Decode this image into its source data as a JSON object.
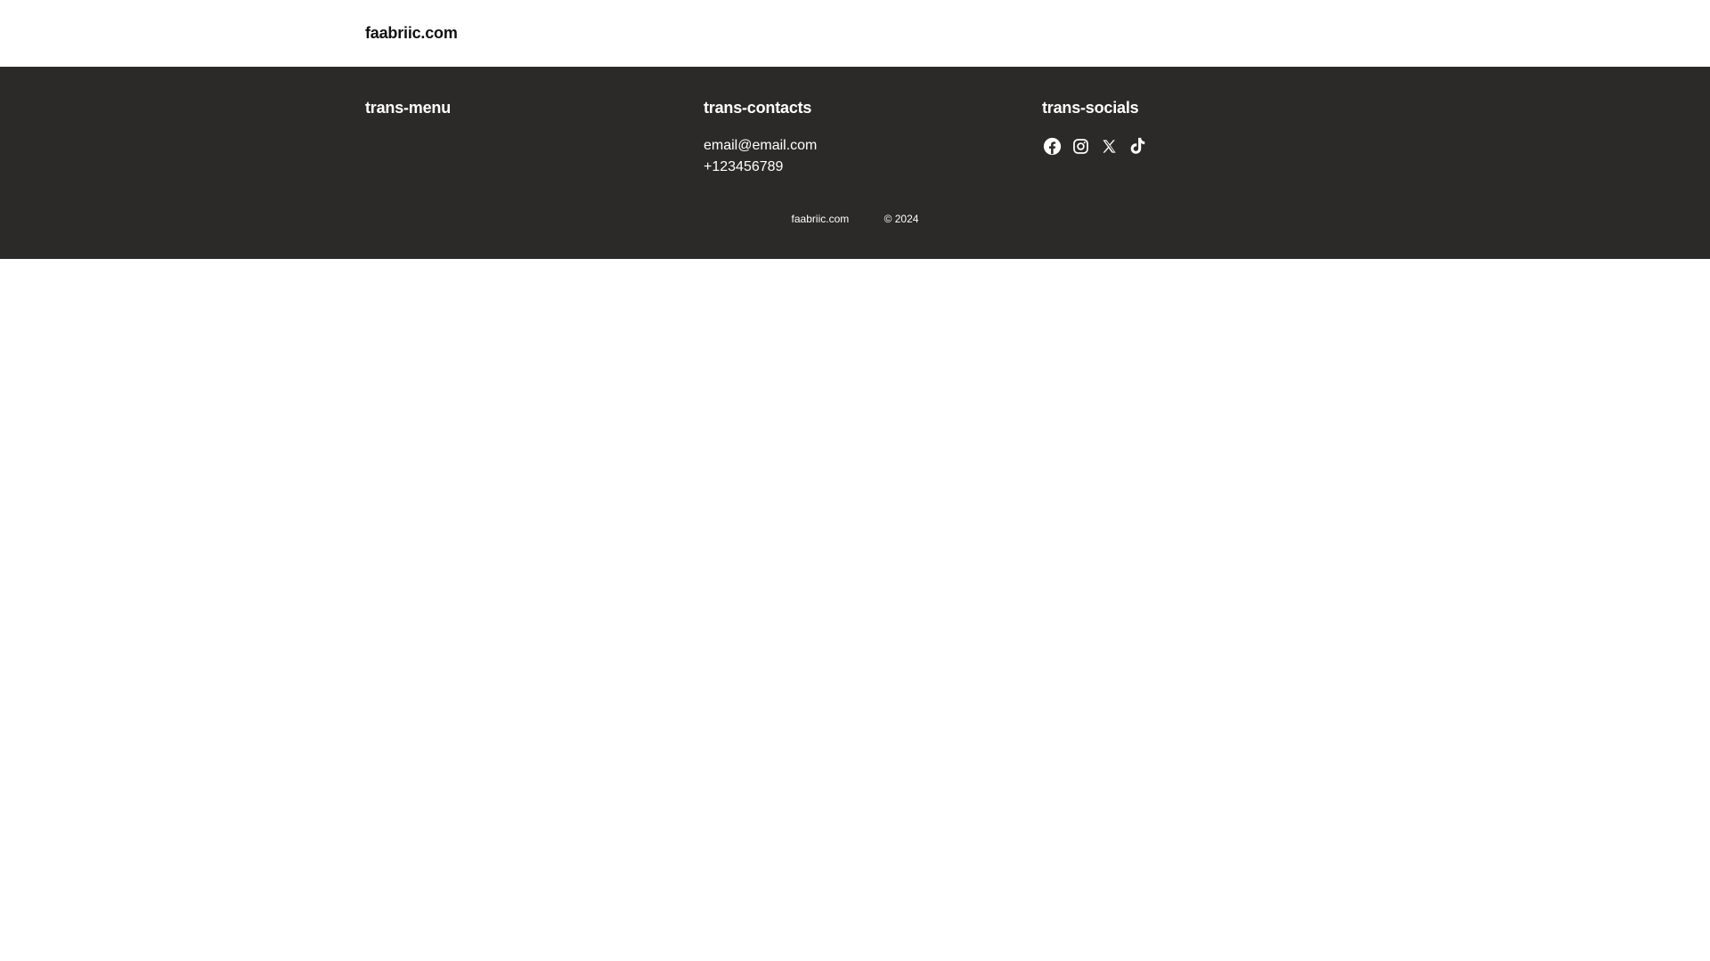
{
  "header": {
    "brand": "faabriic.com"
  },
  "footer": {
    "menu": {
      "title": "trans-menu"
    },
    "contacts": {
      "title": "trans-contacts",
      "email": "email@email.com",
      "phone": "+123456789"
    },
    "socials": {
      "title": "trans-socials",
      "icons": [
        "facebook-icon",
        "instagram-icon",
        "x-icon",
        "tiktok-icon"
      ]
    },
    "bottom": {
      "site": "faabriic.com",
      "copyright": "© 2024"
    }
  },
  "colors": {
    "footer_bg": "#2b2a28",
    "header_bg": "#ffffff",
    "text_light": "#ffffff",
    "text_dark": "#111111"
  }
}
